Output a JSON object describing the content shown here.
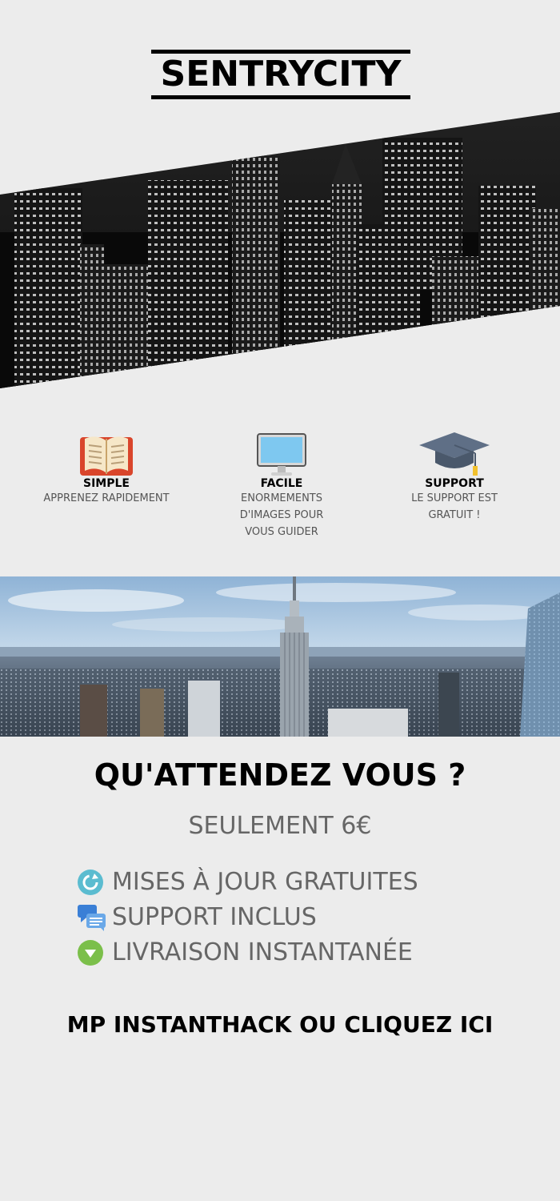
{
  "brand": {
    "name": "SENTRYCITY"
  },
  "features": [
    {
      "title": "SIMPLE",
      "description": "APPRENEZ RAPIDEMENT",
      "icon": "book-icon"
    },
    {
      "title": "FACILE",
      "description": "ENORMEMENTS D'IMAGES POUR VOUS GUIDER",
      "icon": "monitor-icon"
    },
    {
      "title": "SUPPORT",
      "description": "LE SUPPORT EST GRATUIT !",
      "icon": "graduation-cap-icon"
    }
  ],
  "headline": "QU'ATTENDEZ VOUS ?",
  "price": "SEULEMENT 6€",
  "perks": [
    {
      "label": "MISES À JOUR GRATUITES",
      "icon": "refresh-icon",
      "color": "#5bbcd0"
    },
    {
      "label": "SUPPORT INCLUS",
      "icon": "chat-bubbles-icon",
      "color": "#3a7fd6"
    },
    {
      "label": "LIVRAISON INSTANTANÉE",
      "icon": "download-arrow-icon",
      "color": "#7bbf4a"
    }
  ],
  "cta": "MP INSTANTHACK OU CLIQUEZ ICI",
  "colors": {
    "background": "#ececec",
    "text": "#000000",
    "muted": "#666666"
  }
}
